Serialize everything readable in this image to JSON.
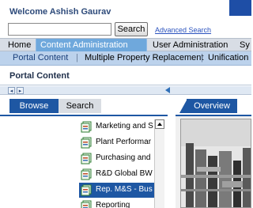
{
  "header": {
    "welcome": "Welcome Ashish Gaurav",
    "search": {
      "value": "",
      "placeholder": "",
      "button_label": "Search"
    },
    "advanced_search_label": "Advanced Search"
  },
  "top_nav": {
    "items": [
      {
        "label": "Home"
      },
      {
        "label": "Content Administration",
        "active": true
      },
      {
        "label": "User Administration"
      },
      {
        "label": "Sy"
      }
    ]
  },
  "sub_nav": {
    "items": [
      {
        "label": "Portal Content",
        "active": true
      },
      {
        "label": "Multiple Property Replacement"
      },
      {
        "label": "Unification"
      }
    ],
    "separator": "|"
  },
  "page_title": "Portal Content",
  "tabs": {
    "browse": "Browse",
    "search": "Search",
    "overview": "Overview"
  },
  "tree": {
    "items": [
      {
        "label": "Marketing and S",
        "icon": "content-folder-icon"
      },
      {
        "label": "Plant Performar",
        "icon": "content-folder-icon"
      },
      {
        "label": "Purchasing and",
        "icon": "content-folder-icon"
      },
      {
        "label": "R&D Global BW",
        "icon": "content-folder-icon"
      },
      {
        "label": "Rep. M&S - Bus",
        "icon": "content-folder-icon",
        "selected": true
      },
      {
        "label": "Reporting",
        "icon": "content-folder-icon"
      }
    ]
  },
  "colors": {
    "brand_blue": "#1e57a3",
    "active_tab": "#6fa8dc",
    "subnav_bg": "#bcd2ec"
  }
}
